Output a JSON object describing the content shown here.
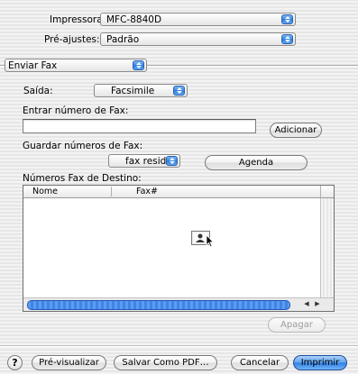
{
  "printer": {
    "label": "Impressora:",
    "value": "MFC-8840D"
  },
  "presets": {
    "label": "Pré-ajustes:",
    "value": "Padrão"
  },
  "pane": {
    "value": "Enviar Fax"
  },
  "output": {
    "label": "Saída:",
    "value": "Facsimile"
  },
  "fax_entry": {
    "label": "Entrar número de Fax:",
    "value": "",
    "add_button": "Adicionar"
  },
  "saved_numbers": {
    "label": "Guardar números de Fax:",
    "value": "fax resid.",
    "agenda_button": "Agenda"
  },
  "destination": {
    "label": "Números Fax de Destino:",
    "columns": [
      "Nome",
      "Fax#"
    ],
    "rows": []
  },
  "delete_button": "Apagar",
  "footer": {
    "help": "?",
    "preview": "Pré-visualizar",
    "save_pdf": "Salvar Como PDF…",
    "cancel": "Cancelar",
    "print": "Imprimir"
  },
  "colors": {
    "accent": "#2f7fe3",
    "accent_border": "#1f4e9c"
  }
}
